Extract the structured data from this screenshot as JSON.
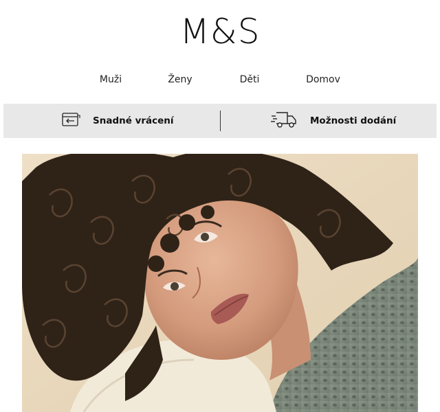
{
  "brand": {
    "logo_text": "M&S"
  },
  "nav": {
    "items": [
      {
        "label": "Muži"
      },
      {
        "label": "Ženy"
      },
      {
        "label": "Děti"
      },
      {
        "label": "Domov"
      }
    ]
  },
  "benefits": {
    "returns": {
      "label": "Snadné vrácení",
      "icon": "return-box-icon"
    },
    "delivery": {
      "label": "Možnosti dodání",
      "icon": "delivery-truck-icon"
    }
  },
  "hero": {
    "image": "woman-curly-hair-portrait"
  }
}
